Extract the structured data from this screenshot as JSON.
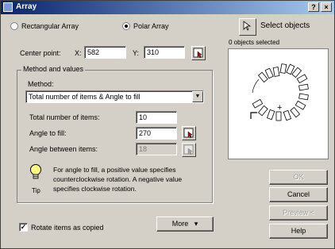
{
  "window": {
    "title": "Array",
    "help_button": "?",
    "close_button": "×"
  },
  "array_type": {
    "rectangular_label": "Rectangular Array",
    "polar_label": "Polar Array",
    "selected": "polar"
  },
  "select_objects": {
    "label": "Select objects",
    "status": "0 objects selected"
  },
  "center_point": {
    "label": "Center point:",
    "x_label": "X:",
    "x_value": "582",
    "y_label": "Y:",
    "y_value": "310"
  },
  "method_group": {
    "title": "Method and values",
    "method_label": "Method:",
    "method_value": "Total number of items & Angle to fill",
    "total_items_label": "Total number of items:",
    "total_items_value": "10",
    "angle_fill_label": "Angle to fill:",
    "angle_fill_value": "270",
    "angle_between_label": "Angle between items:",
    "angle_between_value": "18"
  },
  "tip": {
    "icon_label": "Tip",
    "line1": "For angle to fill, a positive value specifies",
    "line2": "counterclockwise rotation.  A negative value",
    "line3": "specifies clockwise rotation."
  },
  "rotate_items": {
    "label": "Rotate items as copied",
    "checked": true,
    "check_glyph": "✓"
  },
  "buttons": {
    "more": "More",
    "more_glyph": "▾",
    "ok": "OK",
    "cancel": "Cancel",
    "preview": "Preview <",
    "help": "Help"
  },
  "preview_center_glyph": "+"
}
